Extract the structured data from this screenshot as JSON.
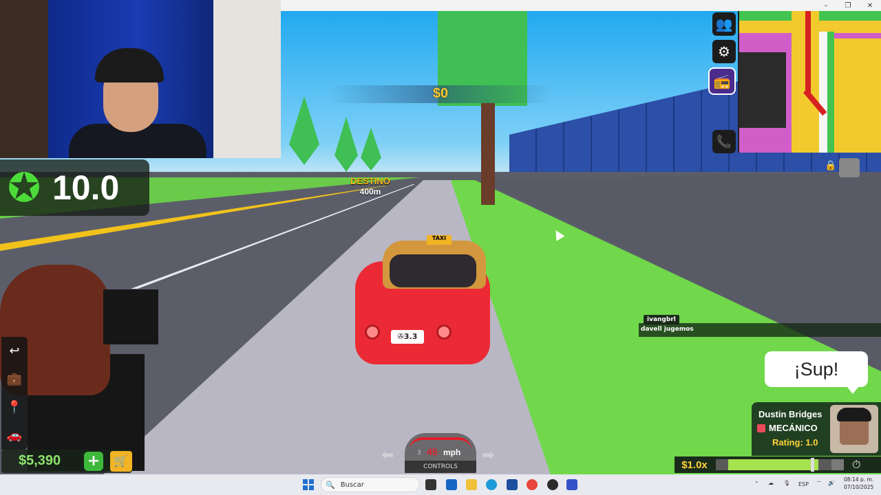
{
  "window": {
    "minimize": "–",
    "maximize": "❐",
    "close": "✕"
  },
  "hud": {
    "rating": {
      "icon": "star-badge-icon",
      "value": "10.0"
    },
    "money_earned": "$0",
    "destination": {
      "label": "DESTINO",
      "distance": "400m"
    },
    "cash": {
      "value": "$5,390",
      "add_label": "+",
      "shop_icon": "shopping-cart-icon"
    },
    "speedometer": {
      "gear": "3",
      "speed": "45",
      "unit": "mph",
      "controls_label": "CONTROLS"
    },
    "multiplier": {
      "label": "$1.0x",
      "fill_fraction": 0.87,
      "marker_fraction": 0.8
    }
  },
  "side_buttons": [
    {
      "name": "players-icon",
      "glyph": "👥"
    },
    {
      "name": "settings-gear-icon",
      "glyph": "⚙"
    },
    {
      "name": "radio-icon",
      "glyph": "📻"
    }
  ],
  "phone_icon": "📞",
  "left_buttons": [
    {
      "name": "back-arrow-icon",
      "glyph": "↩"
    },
    {
      "name": "briefcase-icon",
      "glyph": "💼"
    },
    {
      "name": "map-pin-icon",
      "glyph": "📍"
    },
    {
      "name": "car-icon",
      "glyph": "🚗"
    }
  ],
  "chat": {
    "username": "ivangbrl",
    "message": "davell jugemos"
  },
  "speech_bubble": "¡Sup!",
  "passenger": {
    "name": "Dustin Bridges",
    "role": "MECÁNICO",
    "rating": "Rating: 1.0"
  },
  "car": {
    "taxi_sign": "TAXI",
    "plate": "✇3.3"
  },
  "taskbar": {
    "search_placeholder": "Buscar",
    "tray": {
      "language": "ESP",
      "time": "08:14 p. m.",
      "date": "07/10/2025"
    }
  },
  "colors": {
    "accent_green": "#70d84a",
    "money_yellow": "#f6c731",
    "rating_star": "#4cdc3a"
  }
}
